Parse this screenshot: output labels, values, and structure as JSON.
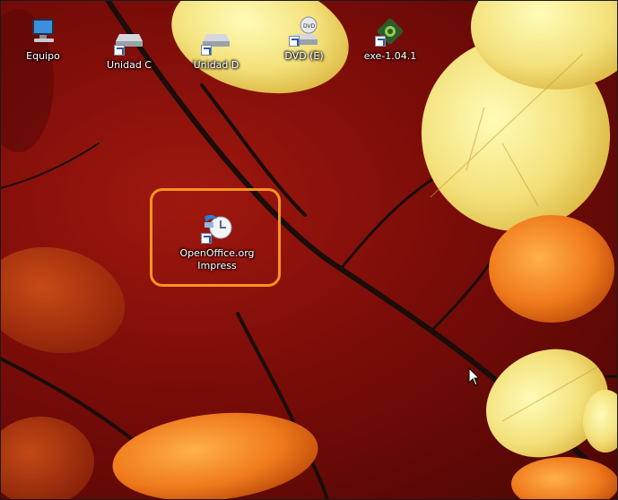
{
  "desktop": {
    "icons": [
      {
        "label": "Equipo",
        "icon": "computer-icon"
      },
      {
        "label": "Unidad C",
        "icon": "drive-c-icon"
      },
      {
        "label": "Unidad D",
        "icon": "drive-d-icon"
      },
      {
        "label": "DVD (E)",
        "icon": "dvd-drive-icon"
      },
      {
        "label": "exe-1.04.1",
        "icon": "exe-app-icon"
      },
      {
        "label": "OpenOffice.org\nImpress",
        "icon": "openoffice-impress-icon"
      }
    ],
    "highlight_color": "#f7941d"
  }
}
